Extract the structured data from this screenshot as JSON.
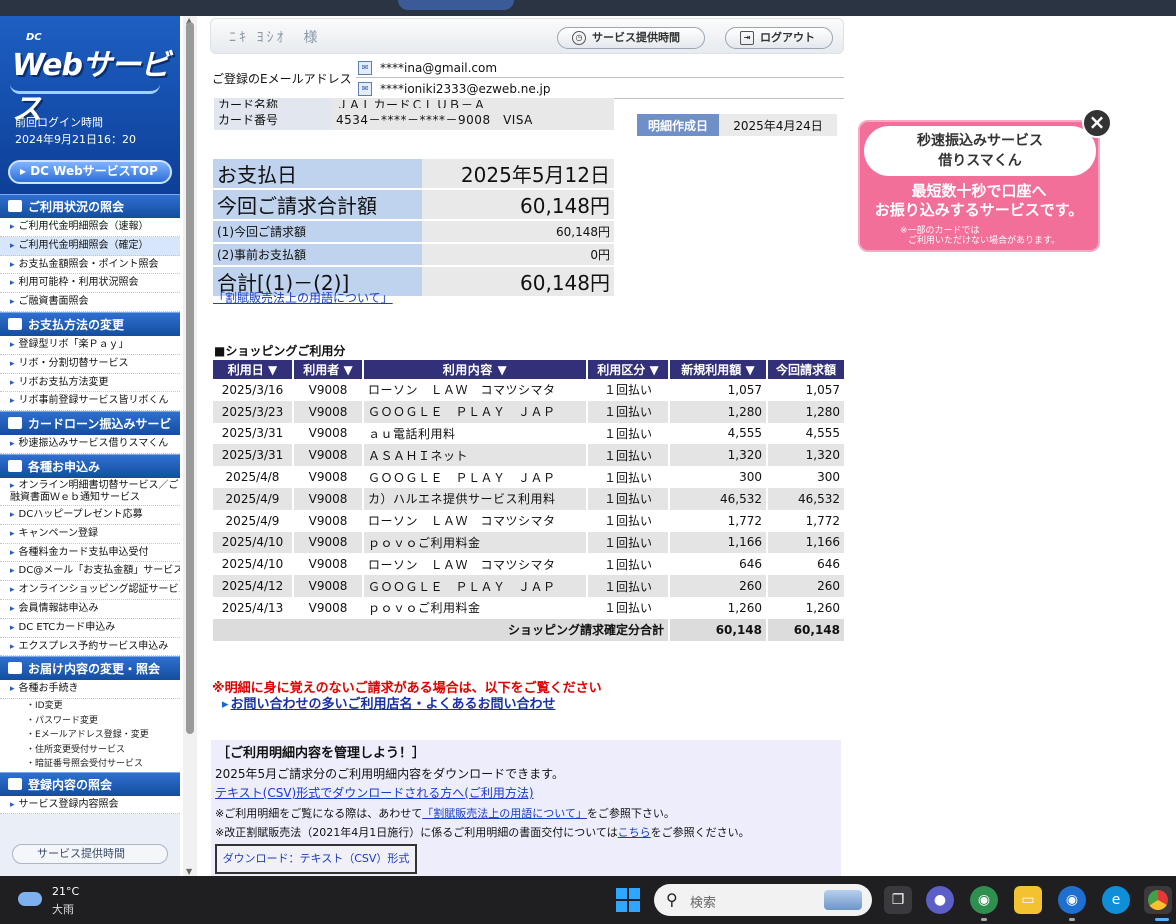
{
  "sidebar": {
    "logo_small": "DC",
    "logo_main": "Webサービス",
    "last_login_label": "前回ログイン時間",
    "last_login_value": "2024年9月21日16：20",
    "top_button": "DC WebサービスTOP",
    "sections": [
      {
        "title": "ご利用状況の照会",
        "items": [
          "ご利用代金明細照会（速報）",
          "ご利用代金明細照会（確定）",
          "お支払金額照会・ポイント照会",
          "利用可能枠・利用状況照会",
          "ご融資書面照会"
        ]
      },
      {
        "title": "お支払方法の変更",
        "items": [
          "登録型リボ「楽Ｐａｙ」",
          "リボ・分割切替サービス",
          "リボお支払方法変更",
          "リボ事前登録サービス皆リボくん"
        ]
      },
      {
        "title": "カードローン振込みサービス",
        "items": [
          "秒速振込みサービス借りスマくん"
        ]
      },
      {
        "title": "各種お申込み",
        "items": [
          "オンライン明細書切替サービス／ご融資書面Ｗｅｂ通知サービス",
          "DCハッピープレゼント応募",
          "キャンペーン登録",
          "各種料金カード支払申込受付",
          "DC@メール「お支払金額」サービス",
          "オンラインショッピング認証サービス",
          "会員情報誌申込み",
          "DC ETCカード申込み",
          "エクスプレス予約サービス申込み"
        ]
      },
      {
        "title": "お届け内容の変更・照会",
        "items": [
          "各種お手続き"
        ],
        "subitems": [
          "ID変更",
          "パスワード変更",
          "Eメールアドレス登録・変更",
          "住所変更受付サービス",
          "暗証番号照会受付サービス"
        ]
      },
      {
        "title": "登録内容の照会",
        "items": [
          "サービス登録内容照会"
        ]
      }
    ],
    "bottom_button": "サービス提供時間"
  },
  "header": {
    "user_name": "ﾆｷ ﾖｼｵ　様",
    "service_hours_button": "サービス提供時間",
    "logout_button": "ログアウト"
  },
  "email": {
    "label": "ご登録のEメールアドレス",
    "pc": "****ina@gmail.com",
    "mobile": "****ionik​i2333@ezweb.ne.jp"
  },
  "card": {
    "name_label": "カード名称",
    "name_value": "ＪＡＬカードＣＬＵＢ－Ａ",
    "number_label": "カード番号",
    "number_value": "4534－****－****－9008　VISA"
  },
  "statement": {
    "created_label": "明細作成日",
    "created_value": "2025年4月24日"
  },
  "payment": {
    "due_label": "お支払日",
    "due_value": "2025年5月12日",
    "total_label": "今回ご請求合計額",
    "total_value": "60,148円",
    "current_label": "(1)今回ご請求額",
    "current_value": "60,148円",
    "prior_label": "(2)事前お支払額",
    "prior_value": "0円",
    "sum_label": "合計[(1)－(2)]",
    "sum_value": "60,148円",
    "terms_link": "「割賦販売法上の用語について」"
  },
  "shopping": {
    "title": "■ショッピングご利用分",
    "headers": [
      "利用日 ▼",
      "利用者 ▼",
      "利用内容 ▼",
      "利用区分 ▼",
      "新規利用額 ▼",
      "今回請求額"
    ],
    "rows": [
      [
        "2025/3/16",
        "V9008",
        "ローソン　ＬＡＷ　コマツシマタ",
        "１回払い",
        "1,057",
        "1,057"
      ],
      [
        "2025/3/23",
        "V9008",
        "ＧＯＯＧＬＥ　ＰＬＡＹ　ＪＡＰ",
        "１回払い",
        "1,280",
        "1,280"
      ],
      [
        "2025/3/31",
        "V9008",
        "ａｕ電話利用料",
        "１回払い",
        "4,555",
        "4,555"
      ],
      [
        "2025/3/31",
        "V9008",
        "ＡＳＡＨＩネット",
        "１回払い",
        "1,320",
        "1,320"
      ],
      [
        "2025/4/8",
        "V9008",
        "ＧＯＯＧＬＥ　ＰＬＡＹ　ＪＡＰ",
        "１回払い",
        "300",
        "300"
      ],
      [
        "2025/4/9",
        "V9008",
        "カ）ハルエネ提供サービス利用料",
        "１回払い",
        "46,532",
        "46,532"
      ],
      [
        "2025/4/9",
        "V9008",
        "ローソン　ＬＡＷ　コマツシマタ",
        "１回払い",
        "1,772",
        "1,772"
      ],
      [
        "2025/4/10",
        "V9008",
        "ｐｏｖｏご利用料金",
        "１回払い",
        "1,166",
        "1,166"
      ],
      [
        "2025/4/10",
        "V9008",
        "ローソン　ＬＡＷ　コマツシマタ",
        "１回払い",
        "646",
        "646"
      ],
      [
        "2025/4/12",
        "V9008",
        "ＧＯＯＧＬＥ　ＰＬＡＹ　ＪＡＰ",
        "１回払い",
        "260",
        "260"
      ],
      [
        "2025/4/13",
        "V9008",
        "ｐｏｖｏご利用料金",
        "１回払い",
        "1,260",
        "1,260"
      ]
    ],
    "total_label": "ショッピング請求確定分合計",
    "total_new": "60,148",
    "total_current": "60,148"
  },
  "notice": {
    "warning": "※明細に身に覚えのないご請求がある場合は、以下をご覧ください",
    "link": "お問い合わせの多いご利用店名・よくあるお問い合わせ"
  },
  "manage": {
    "title": "［ご利用明細内容を管理しよう！］",
    "line1": "2025年5月ご請求分のご利用明細内容をダウンロードできます。",
    "csv_link": "テキスト(CSV)形式でダウンロードされる方へ(ご利用方法)",
    "line3_pre": "※ご利用明細をご覧になる際は、あわせて",
    "line3_link": "「割賦販売法上の用語について」",
    "line3_post": "をご参照下さい。",
    "line4_pre": "※改正割賦販売法（2021年4月1日施行）に係るご利用明細の書面交付については",
    "line4_link": "こちら",
    "line4_post": "をご参照ください。",
    "download_button": "ダウンロード：テキスト（CSV）形式"
  },
  "ad": {
    "title_line1": "秒速振込みサービス",
    "title_line2": "借りスマくん",
    "main_line1": "最短数十秒で口座へ",
    "main_line2": "お振り込みするサービスです。",
    "note_line1": "※一部のカードでは",
    "note_line2": "ご利用いただけない場合があります。"
  },
  "taskbar": {
    "temperature": "21°C",
    "weather": "大雨",
    "search_placeholder": "検索"
  }
}
